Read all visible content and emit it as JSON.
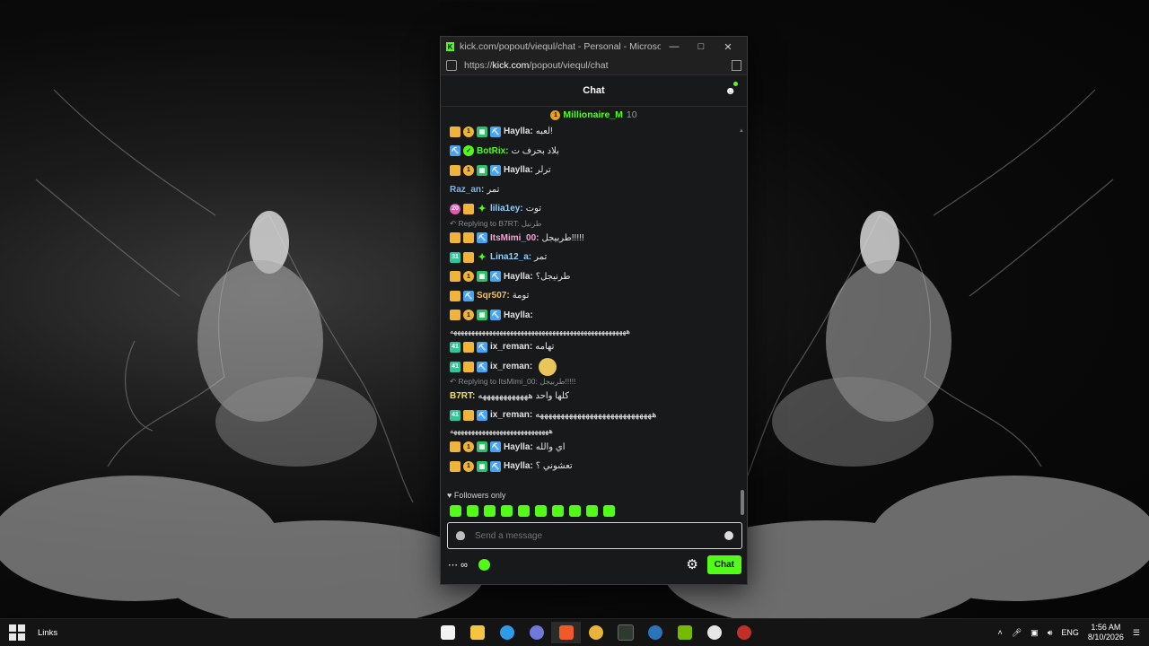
{
  "browser": {
    "title": "kick.com/popout/viequl/chat - Personal - Microsoft Ed...",
    "url_prefix": "https://",
    "url_host": "kick.com",
    "url_path": "/popout/viequl/chat"
  },
  "chat": {
    "header": "Chat",
    "pinned_user": "Millionaire_M",
    "pinned_count": "10",
    "followers_only": "Followers only",
    "input_placeholder": "Send a message",
    "send_label": "Chat",
    "points": "∞",
    "messages": [
      {
        "user": "Haylla:",
        "text": "لعبه!"
      },
      {
        "user": "BotRix:",
        "text": "بلاد بحرف ت"
      },
      {
        "user": "Haylla:",
        "text": "ترلر"
      },
      {
        "user": "Raz_an:",
        "text": "تمر"
      },
      {
        "user": "lilia1ey:",
        "text": "توت"
      },
      {
        "reply": "Replying to B7RT: طرنيل"
      },
      {
        "user": "ItsMimi_00:",
        "text": "طربيجل!!!!!"
      },
      {
        "user": "Lina12_a:",
        "text": "تمر"
      },
      {
        "user": "Haylla:",
        "text": "طرنيجل؟"
      },
      {
        "user": "Sqr507:",
        "text": "تومة"
      },
      {
        "user": "Haylla:",
        "text": ""
      },
      {
        "cont": "ههههههههههههههههههههههههههههههههههههههههههههههههههه"
      },
      {
        "user": "ix_reman:",
        "text": "تهامه"
      },
      {
        "user": "ix_reman:",
        "text": ""
      },
      {
        "reply": "Replying to ItsMimi_00: طربيجل!!!!!"
      },
      {
        "user": "B7RT:",
        "text": "كلها واحد ههههههههههههه"
      },
      {
        "user": "ix_reman:",
        "text": "ههههههههههههههههههههههههههههه"
      },
      {
        "cont": "ههههههههههههههههههههههههههههه"
      },
      {
        "user": "Haylla:",
        "text": "اي والله"
      },
      {
        "user": "Haylla:",
        "text": "تعشوني ؟"
      }
    ]
  },
  "taskbar": {
    "links_label": "Links",
    "lang": "ENG",
    "time": "1:56 AM",
    "date": "8/10/2026"
  },
  "colors": {
    "kick_green": "#53fc18",
    "chat_bg": "#18191b"
  }
}
